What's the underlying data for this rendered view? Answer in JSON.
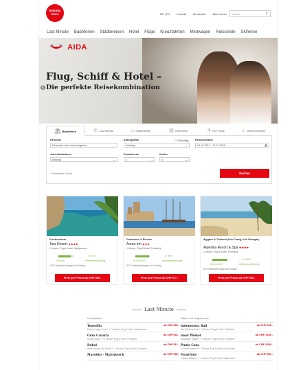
{
  "brand": {
    "logo_text": "helvetic tours"
  },
  "top_links": [
    "DE | FR",
    "Kontakt",
    "Merkzettel",
    "Mein Konto"
  ],
  "search": {
    "placeholder": "Suche"
  },
  "nav": [
    "Last Minute",
    "Badeferien",
    "Städtereisen",
    "Hotel",
    "Flüge",
    "Kreuzfahrten",
    "Mietwagen",
    "Reiseziele",
    "Skiferien"
  ],
  "hero": {
    "brand": "AIDA",
    "title": "Flug, Schiff & Hotel –",
    "subtitle": "Die perfekte Reisekombination"
  },
  "booking": {
    "tabs": [
      {
        "label": "Badeferien",
        "icon": "beach-icon",
        "active": true
      },
      {
        "label": "Last Minute",
        "icon": "clock-icon",
        "active": false
      },
      {
        "label": "Städtereisen",
        "icon": "city-icon",
        "active": false
      },
      {
        "label": "Citymobile",
        "icon": "car-icon",
        "active": false
      },
      {
        "label": "Nur Flüge",
        "icon": "plane-icon",
        "active": false
      },
      {
        "label": "Wellnesshotels",
        "icon": "spa-icon",
        "active": false
      }
    ],
    "fields": {
      "destination_label": "Reiseziel",
      "destination_value": "Reiseziel oder Hotel eingeben",
      "departure_label": "Abflughafen",
      "departure_value": "beliebig",
      "flexible_label": "Gleichtag",
      "date_label": "Reisezeitraum",
      "date_value": "01.10.2017 - 11.01.2018",
      "duration_label": "Aufenthaltsdauer",
      "duration_value": "beliebig",
      "adults_label": "Erwachsene",
      "adults_value": "2",
      "children_label": "Kinder",
      "children_value": "0",
      "extended_label": "Erweiterte Suche",
      "search_button": "Suchen"
    }
  },
  "cards": [
    {
      "region": "Fuerteventura",
      "hotel": "Tara Resort",
      "stars": "★★★★",
      "desc": "1 Woche, Flug & Hotel, Halbpension",
      "rating": "5 von 6",
      "rating_fraction": 0.83,
      "recommend": "93%",
      "recommend_label": "Weiterempfehlung",
      "reviews": "1462 Hotelbewertungen auf Holiday",
      "price": "Preis pro Person ab CHP 380.-"
    },
    {
      "region": "Dodekanes & Rhodos",
      "hotel": "Arena Inn",
      "stars": "★★★",
      "desc": "1 Woche, Flug & Hotel, Frühstück",
      "rating": "5.4 von 6.0",
      "rating_fraction": 0.9,
      "recommend": "90%",
      "recommend_label": "Weiterempfehlung",
      "reviews": "877 Hotelbewertungen auf Holiday",
      "price": "Preis pro Person ab CHP 377.-"
    },
    {
      "region": "Ägypten & Thailand (Koh Chang, Koh Phangan)",
      "hotel": "Aliyedna Resort & Spa",
      "stars": "★★★★",
      "desc": "1 Woche, Flug & Hotel, Frühstück",
      "rating": "5.9 von 6.0",
      "rating_fraction": 0.98,
      "recommend": "100%",
      "recommend_label": "Weiterempfehlung",
      "reviews": "50 Hotelbewertungen auf Holiday",
      "price": "Preis pro Person ab CHP 545.-"
    }
  ],
  "last_minute": {
    "title": "Last Minute",
    "columns": [
      {
        "heading": "Kurzstrecken",
        "rows": [
          {
            "dest": "Teneriffa",
            "price": "ab CHP 385.-",
            "sub": "Palacio Lagos Hotel **** 1 Woche, Flug & Hotel, Halbpension"
          },
          {
            "dest": "Gran Canaria",
            "price": "ab CHP 451.-",
            "sub": "Gloria Palace *** 1 Woche, Flug & Hotel, Frühstück"
          },
          {
            "dest": "Dubai",
            "price": "ab CHP 511.-",
            "sub": "Hilton Garden Inn Dubai *** 1 Woche, Flug & Hotel, Frühstück"
          },
          {
            "dest": "Marokko - Marrakesch",
            "price": "ab CHP 535.-",
            "sub": ""
          }
        ]
      },
      {
        "heading": "Mittel- und Langstrecken",
        "rows": [
          {
            "dest": "Indonesien: Bali",
            "price": "ab CHP 918.-",
            "sub": "Ibis Bali Kuta Kuta ** 1 Woche, Flug & Hotel, Frühstück"
          },
          {
            "dest": "Insel Phuket",
            "price": "ab CHP 1028.-",
            "sub": "Sawasdee Village *** 1 Woche, Flug & Hotel, Frühstück"
          },
          {
            "dest": "Punta Cana",
            "price": "ab CHP 1058.-",
            "sub": "Vik Hotel Arena **** 1 Woche, Flug & Hotel, All Inclusive"
          },
          {
            "dest": "Mauritius",
            "price": "ab CHP 850.-",
            "sub": "Tropical Attitude *** 1 Woche, Flug & Hotel, Halbpension"
          }
        ]
      }
    ]
  }
}
